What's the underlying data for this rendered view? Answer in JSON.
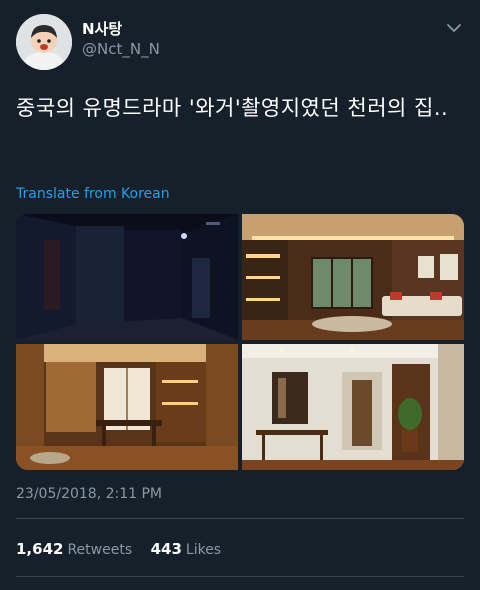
{
  "author": {
    "name": "N사탕",
    "handle": "@Nct_N_N"
  },
  "tweet": {
    "text": "중국의 유명드라마 '와거'촬영지였던 천러의 집..",
    "translate_label": "Translate from Korean",
    "timestamp": "23/05/2018, 2:11 PM"
  },
  "stats": {
    "retweets_count": "1,642",
    "retweets_label": "Retweets",
    "likes_count": "443",
    "likes_label": "Likes"
  },
  "colors": {
    "background": "#15202b",
    "link": "#1da1f2",
    "muted": "#8899a6"
  }
}
